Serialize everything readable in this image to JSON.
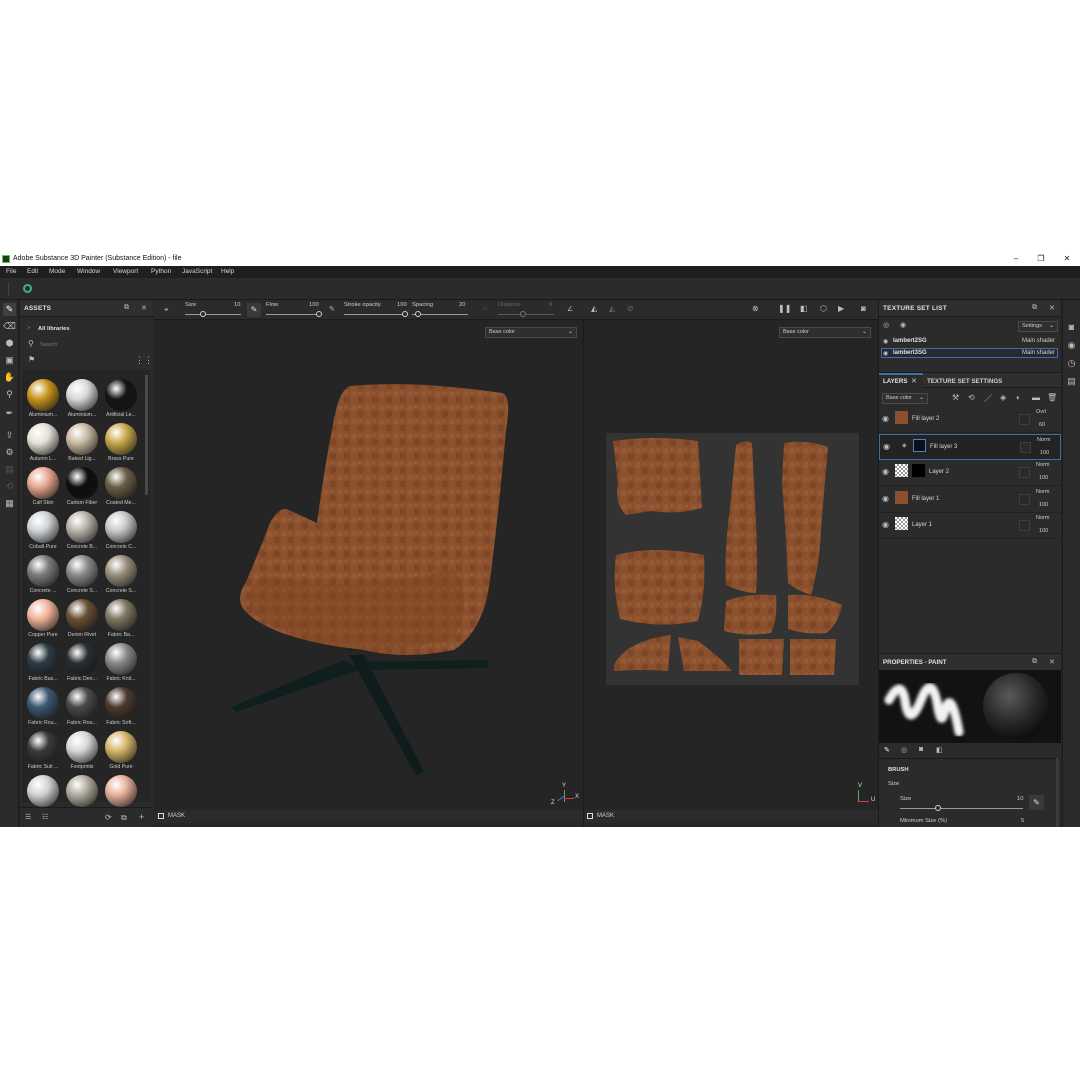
{
  "window": {
    "title": "Adobe Substance 3D Painter (Substance Edition) - file",
    "app_icon": "Pt",
    "minimize": "–",
    "maximize": "❐",
    "close": "✕"
  },
  "menu": [
    "File",
    "Edit",
    "Mode",
    "Window",
    "Viewport",
    "Python",
    "JavaScript",
    "Help"
  ],
  "toolbar": {
    "size_label": "Size",
    "size_value": "10",
    "flow_label": "Flow",
    "flow_value": "100",
    "stroke_opacity_label": "Stroke opacity",
    "stroke_opacity_value": "100",
    "spacing_label": "Spacing",
    "spacing_value": "20",
    "distance_label": "Distance",
    "distance_value": "9"
  },
  "assets": {
    "title": "ASSETS",
    "library": "All libraries",
    "search_placeholder": "Search",
    "materials": [
      {
        "name": "Aluminium...",
        "color": "#c8941e"
      },
      {
        "name": "Aluminium...",
        "color": "#d9d9d9"
      },
      {
        "name": "Artificial Le...",
        "color": "#151515"
      },
      {
        "name": "Autumn L...",
        "color": "#e6e0d8"
      },
      {
        "name": "Baked Lig...",
        "color": "#c9b9a0"
      },
      {
        "name": "Brass Pure",
        "color": "#c9a84c"
      },
      {
        "name": "Calf Skin",
        "color": "#e8a790"
      },
      {
        "name": "Carbon Fiber",
        "color": "#0e0e0e"
      },
      {
        "name": "Coated Me...",
        "color": "#6a5e48"
      },
      {
        "name": "Cobalt Pure",
        "color": "#cfd3d6"
      },
      {
        "name": "Concrete B...",
        "color": "#b8b2a8"
      },
      {
        "name": "Concrete C...",
        "color": "#c8c8c8"
      },
      {
        "name": "Concrete ...",
        "color": "#7b7b7b"
      },
      {
        "name": "Concrete S...",
        "color": "#8a8a8a"
      },
      {
        "name": "Concrete S...",
        "color": "#9a8e7c"
      },
      {
        "name": "Copper Pure",
        "color": "#f0b39a"
      },
      {
        "name": "Denim Rivet",
        "color": "#6a5034"
      },
      {
        "name": "Fabric Ba...",
        "color": "#7d7860"
      },
      {
        "name": "Fabric Bas...",
        "color": "#2d3b45"
      },
      {
        "name": "Fabric Den...",
        "color": "#2a2e33"
      },
      {
        "name": "Fabric Knit...",
        "color": "#8a8a8a"
      },
      {
        "name": "Fabric Rou...",
        "color": "#3d5872"
      },
      {
        "name": "Fabric Rou...",
        "color": "#4a4a4a"
      },
      {
        "name": "Fabric Soft...",
        "color": "#4e3a30"
      },
      {
        "name": "Fabric Suit ...",
        "color": "#3a3a3a"
      },
      {
        "name": "Footprints",
        "color": "#d8d8d8"
      },
      {
        "name": "Gold Pure",
        "color": "#d7b66a"
      },
      {
        "name": "",
        "color": "#d2d2d2"
      },
      {
        "name": "",
        "color": "#b0ab9c"
      },
      {
        "name": "",
        "color": "#e8b09c"
      }
    ]
  },
  "viewport3d": {
    "channel": "Base color",
    "mask": "MASK",
    "axis_y": "Y",
    "axis_x": "X",
    "axis_z": "Z"
  },
  "viewport2d": {
    "channel": "Base color",
    "mask": "MASK",
    "axis_v": "V",
    "axis_u": "U"
  },
  "texture_sets": {
    "title": "TEXTURE SET LIST",
    "settings": "Settings",
    "items": [
      {
        "name": "lambert2SG",
        "shader": "Main shader"
      },
      {
        "name": "lambert3SG",
        "shader": "Main shader"
      }
    ]
  },
  "layers": {
    "tab_layers": "LAYERS",
    "tab_tss": "TEXTURE SET SETTINGS",
    "channel": "Base color",
    "items": [
      {
        "name": "Fill layer 2",
        "blend": "Ovrl",
        "opacity": "60"
      },
      {
        "name": "Fill layer 3",
        "blend": "Norm",
        "opacity": "100"
      },
      {
        "name": "Layer 2",
        "blend": "Norm",
        "opacity": "100"
      },
      {
        "name": "Fill layer 1",
        "blend": "Norm",
        "opacity": "100"
      },
      {
        "name": "Layer 1",
        "blend": "Norm",
        "opacity": "100"
      }
    ]
  },
  "properties": {
    "title": "PROPERTIES - PAINT",
    "brush": "BRUSH",
    "size_group": "Size",
    "size_label": "Size",
    "size_value": "10",
    "min_size_label": "Minimum Size (%)",
    "min_size_value": "5"
  },
  "colors": {
    "leather": "#8a4e2c",
    "leather_dark": "#6b3a1f",
    "chair_base": "#0f1f1e"
  }
}
